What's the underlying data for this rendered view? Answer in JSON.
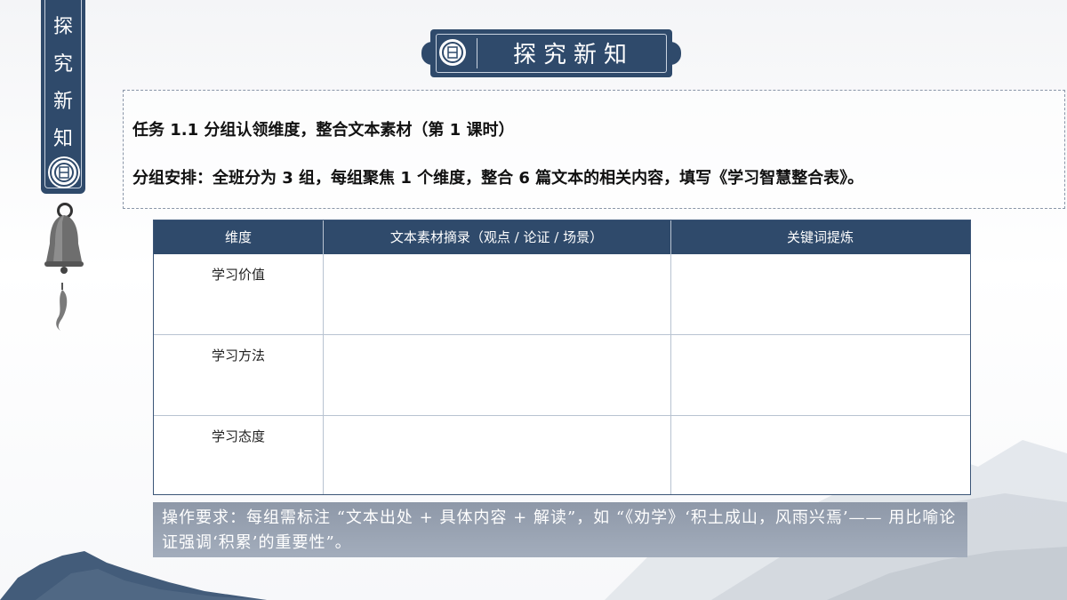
{
  "banner": {
    "chars": [
      "探",
      "究",
      "新",
      "知"
    ]
  },
  "title": "探究新知",
  "task": {
    "line1": "任务 1.1 分组认领维度，整合文本素材（第 1 课时）",
    "line2": "分组安排：全班分为 3 组，每组聚焦 1 个维度，整合 6 篇文本的相关内容，填写《学习智慧整合表》。"
  },
  "table": {
    "headers": [
      "维度",
      "文本素材摘录（观点 / 论证 / 场景）",
      "关键词提炼"
    ],
    "rows": [
      "学习价值",
      "学习方法",
      "学习态度"
    ]
  },
  "note": "操作要求：每组需标注 “文本出处 + 具体内容 + 解读”，如 “《劝学》‘积土成山，风雨兴焉’—— 用比喻论证强调‘积累’的重要性”。",
  "colors": {
    "navy": "#2f4a6b",
    "note_bg": "#98a2b2"
  }
}
